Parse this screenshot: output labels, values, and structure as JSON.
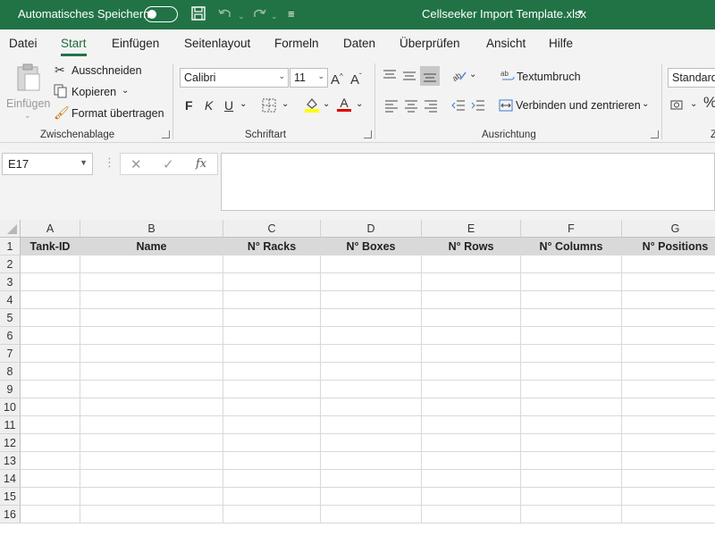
{
  "titlebar": {
    "autosave_label": "Automatisches Speichern",
    "document_title": "Cellseeker Import Template.xlsx",
    "bg_color": "#217346"
  },
  "tabs": [
    "Datei",
    "Start",
    "Einfügen",
    "Seitenlayout",
    "Formeln",
    "Daten",
    "Überprüfen",
    "Ansicht",
    "Hilfe"
  ],
  "active_tab": "Start",
  "ribbon": {
    "clipboard": {
      "paste_label": "Einfügen",
      "cut_label": "Ausschneiden",
      "copy_label": "Kopieren",
      "format_painter_label": "Format übertragen",
      "group_label": "Zwischenablage"
    },
    "font": {
      "font_name": "Calibri",
      "font_size": "11",
      "bold_label": "F",
      "italic_label": "K",
      "underline_label": "U",
      "group_label": "Schriftart",
      "fill_color": "#ffff00",
      "font_color": "#e00000"
    },
    "alignment": {
      "wrap_label": "Textumbruch",
      "merge_label": "Verbinden und zentrieren",
      "group_label": "Ausrichtung"
    },
    "number": {
      "format_value": "Standard",
      "group_label_partial": "Z"
    }
  },
  "formula_bar": {
    "name_box": "E17",
    "formula": ""
  },
  "sheet": {
    "columns": [
      "A",
      "B",
      "C",
      "D",
      "E",
      "F",
      "G"
    ],
    "rows": [
      "1",
      "2",
      "3",
      "4",
      "5",
      "6",
      "7",
      "8",
      "9",
      "10",
      "11",
      "12",
      "13",
      "14",
      "15",
      "16"
    ],
    "header_row": [
      "Tank-ID",
      "Name",
      "N° Racks",
      "N° Boxes",
      "N° Rows",
      "N° Columns",
      "N° Positions"
    ]
  }
}
